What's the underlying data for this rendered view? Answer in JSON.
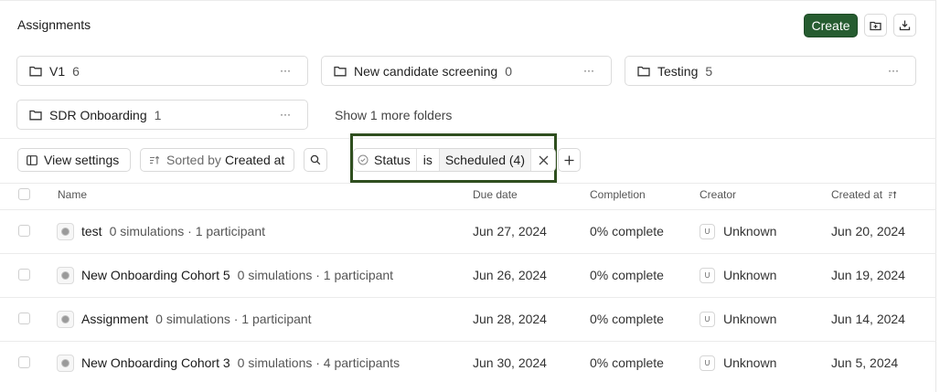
{
  "header": {
    "title": "Assignments",
    "create_label": "Create",
    "icons": [
      "folder-plus-icon",
      "download-icon"
    ]
  },
  "folders": [
    {
      "name": "V1",
      "count": "6",
      "more": "···"
    },
    {
      "name": "New candidate screening",
      "count": "0",
      "more": "···"
    },
    {
      "name": "Testing",
      "count": "5",
      "more": "···"
    },
    {
      "name": "SDR Onboarding",
      "count": "1",
      "more": "···"
    }
  ],
  "show_more_folders": "Show 1 more folders",
  "toolbar": {
    "view_settings": "View settings",
    "sorted_by_prefix": "Sorted by",
    "sorted_by_value": "Created at",
    "filter": {
      "field": "Status",
      "operator": "is",
      "value": "Scheduled (4)"
    },
    "filter_accent": "#2f4f1f"
  },
  "table": {
    "columns": [
      "Name",
      "Due date",
      "Completion",
      "Creator",
      "Created at"
    ],
    "rows": [
      {
        "name": "test",
        "details": "0 simulations · 1 participant",
        "due": "Jun 27, 2024",
        "completion": "0% complete",
        "creator_initial": "U",
        "creator": "Unknown",
        "created": "Jun 20, 2024"
      },
      {
        "name": "New Onboarding Cohort 5",
        "details": "0 simulations · 1 participant",
        "due": "Jun 26, 2024",
        "completion": "0% complete",
        "creator_initial": "U",
        "creator": "Unknown",
        "created": "Jun 19, 2024"
      },
      {
        "name": "Assignment",
        "details": "0 simulations · 1 participant",
        "due": "Jun 28, 2024",
        "completion": "0% complete",
        "creator_initial": "U",
        "creator": "Unknown",
        "created": "Jun 14, 2024"
      },
      {
        "name": "New Onboarding Cohort 3",
        "details": "0 simulations · 4 participants",
        "due": "Jun 30, 2024",
        "completion": "0% complete",
        "creator_initial": "U",
        "creator": "Unknown",
        "created": "Jun 5, 2024"
      }
    ]
  },
  "colors": {
    "primary": "#265c30",
    "highlight_border": "#2f4f1f"
  }
}
